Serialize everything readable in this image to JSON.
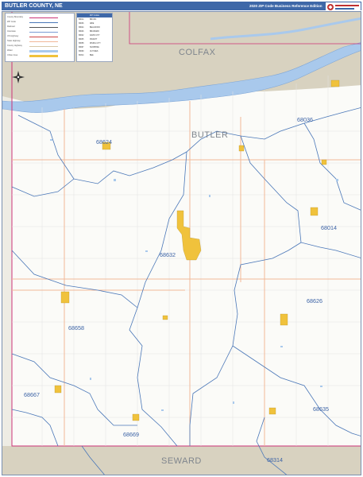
{
  "header": {
    "title": "BUTLER COUNTY, NE",
    "subtitle": "2020 ZIP Code Business Reference Edition",
    "logo_text": "Market MAPS"
  },
  "colors": {
    "header_bg": "#3e68a8",
    "water": "#a9c9ec",
    "neighbor_land": "#d8d2c0",
    "zip_boundary": "#4a77b8",
    "county_boundary": "#cc3377",
    "highway": "#f1b898",
    "urban": "#f0c23c"
  },
  "counties": [
    {
      "name": "COLFAX"
    },
    {
      "name": "BUTLER"
    },
    {
      "name": "SEWARD"
    }
  ],
  "zip_codes": [
    {
      "code": "68036"
    },
    {
      "code": "68624"
    },
    {
      "code": "68014"
    },
    {
      "code": "68632"
    },
    {
      "code": "68626"
    },
    {
      "code": "68658"
    },
    {
      "code": "68667"
    },
    {
      "code": "68635"
    },
    {
      "code": "68669"
    },
    {
      "code": "68314"
    }
  ],
  "legend": {
    "items": [
      "County Boundary",
      "ZIP Code",
      "Railroad",
      "Interstate",
      "US Highway",
      "State Highway",
      "County Highway",
      "Water",
      "Urban Area"
    ]
  },
  "zip_table": {
    "header": "ZIP Codes",
    "rows": [
      [
        "68014",
        "BRUNO"
      ],
      [
        "68036",
        "ABIE"
      ],
      [
        "68624",
        "BELLWOOD"
      ],
      [
        "68626",
        "BRAINARD"
      ],
      [
        "68632",
        "DAVID CITY"
      ],
      [
        "68635",
        "DWIGHT"
      ],
      [
        "68658",
        "RISING CITY"
      ],
      [
        "68667",
        "SURPRISE"
      ],
      [
        "68669",
        "ULYSSES"
      ],
      [
        "68314",
        "BEE"
      ]
    ]
  }
}
